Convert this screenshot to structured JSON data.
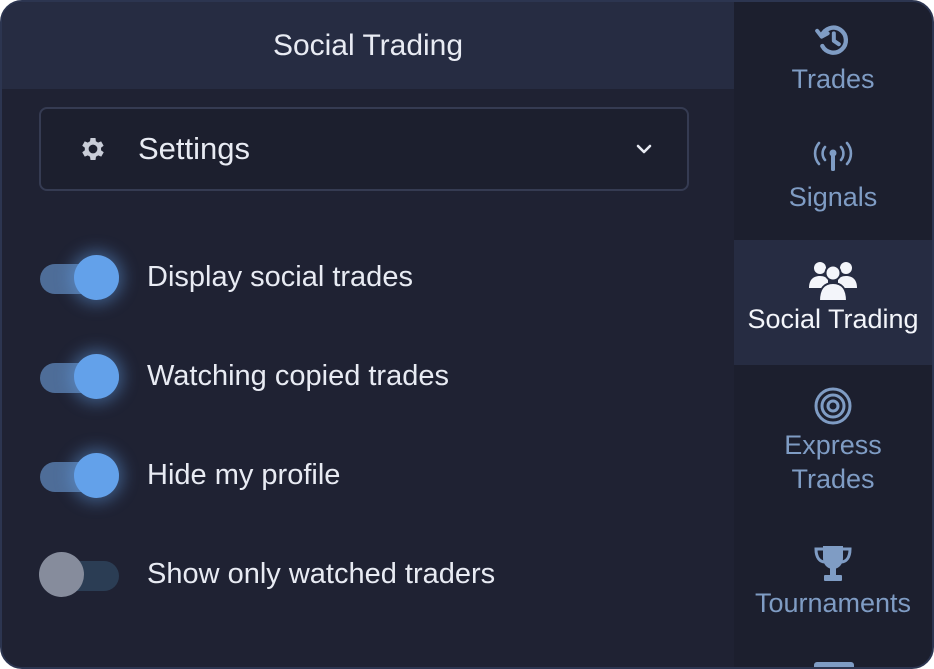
{
  "panel": {
    "title": "Social Trading",
    "settings_dropdown": {
      "label": "Settings"
    },
    "toggles": [
      {
        "label": "Display social trades",
        "enabled": true
      },
      {
        "label": "Watching copied trades",
        "enabled": true
      },
      {
        "label": "Hide my profile",
        "enabled": true
      },
      {
        "label": "Show only watched traders",
        "enabled": false
      }
    ]
  },
  "nav": {
    "items": [
      {
        "label": "Trades",
        "icon": "history-icon",
        "active": false
      },
      {
        "label": "Signals",
        "icon": "antenna-icon",
        "active": false
      },
      {
        "label": "Social Trading",
        "icon": "users-icon",
        "active": true
      },
      {
        "label_line1": "Express",
        "label_line2": "Trades",
        "icon": "target-icon",
        "active": false
      },
      {
        "label": "Tournaments",
        "icon": "trophy-icon",
        "active": false
      }
    ]
  },
  "colors": {
    "background": "#1f2233",
    "header": "#262c42",
    "accent": "#63a1ea",
    "nav_text": "#7f9cc4"
  }
}
